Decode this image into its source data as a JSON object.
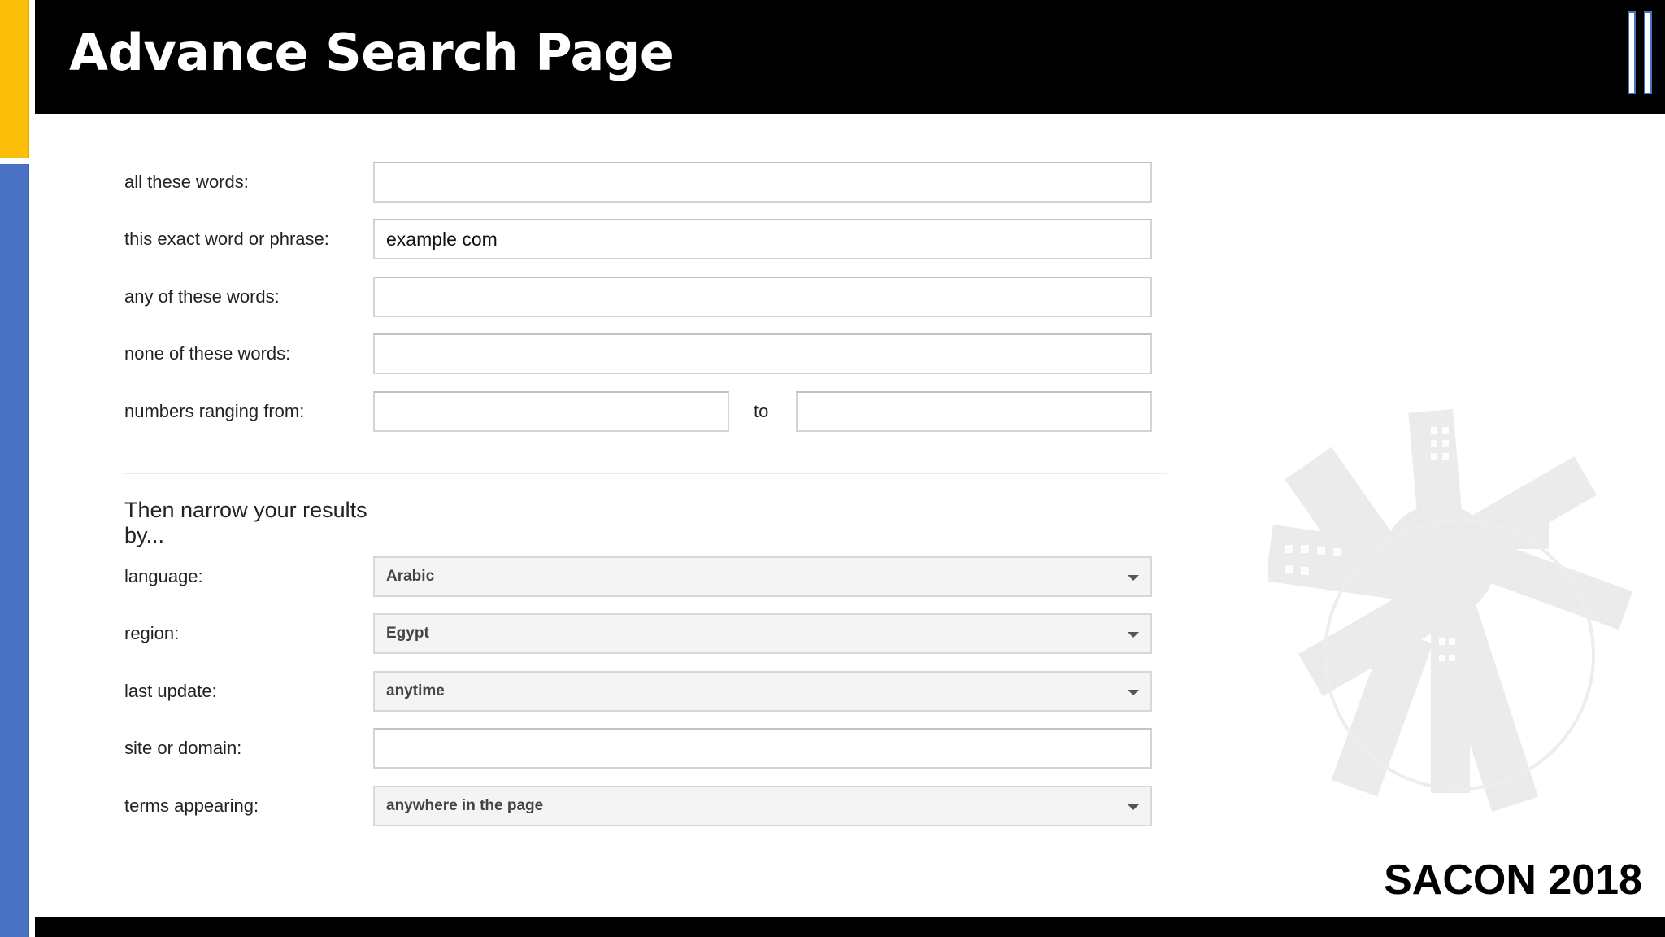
{
  "header": {
    "title": "Advance Search Page"
  },
  "footer": {
    "brand": "SACON 2018"
  },
  "form": {
    "all_words": {
      "label": "all these words:",
      "value": ""
    },
    "exact_phrase": {
      "label": "this exact word or phrase:",
      "value": "example com"
    },
    "any_words": {
      "label": "any of these words:",
      "value": ""
    },
    "none_words": {
      "label": "none of these words:",
      "value": ""
    },
    "numbers": {
      "label": "numbers ranging from:",
      "to_label": "to",
      "from_value": "",
      "to_value": ""
    },
    "narrow_heading": "Then narrow your results by...",
    "language": {
      "label": "language:",
      "selected": "Arabic"
    },
    "region": {
      "label": "region:",
      "selected": "Egypt"
    },
    "last_update": {
      "label": "last update:",
      "selected": "anytime"
    },
    "site_domain": {
      "label": "site or domain:",
      "value": ""
    },
    "terms_appearing": {
      "label": "terms appearing:",
      "selected": "anywhere in the page"
    }
  },
  "colors": {
    "accent_yellow": "#fbbf0a",
    "accent_blue": "#4a72c4",
    "header_bg": "#000000"
  },
  "icons": [
    "dropdown-caret-icon",
    "city-watermark-icon"
  ]
}
